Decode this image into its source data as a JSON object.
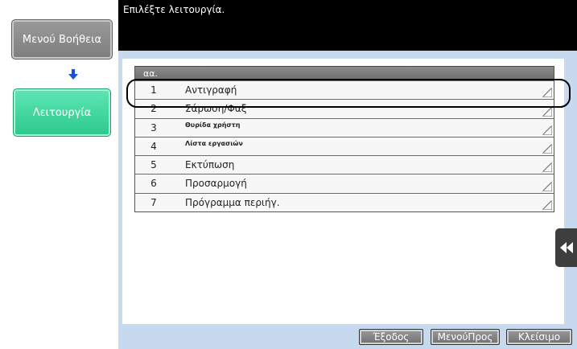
{
  "header": {
    "prompt": "Επιλέξτε λειτουργία."
  },
  "left_panel": {
    "help_menu_label": "Μενού Βοήθεια",
    "function_label": "Λειτουργία"
  },
  "list": {
    "header": "αα.",
    "items": [
      {
        "num": "1",
        "label": "Αντιγραφή",
        "selected": true
      },
      {
        "num": "2",
        "label": "Σάρωση/Φαξ"
      },
      {
        "num": "3",
        "label": "Θυρίδα χρήστη"
      },
      {
        "num": "4",
        "label": "Λίστα εργασιών"
      },
      {
        "num": "5",
        "label": "Εκτύπωση"
      },
      {
        "num": "6",
        "label": "Προσαρμογή"
      },
      {
        "num": "7",
        "label": "Πρόγραμμα περιήγ."
      }
    ]
  },
  "footer": {
    "exit_label": "Έξοδος",
    "menu_label": "ΜενούΠρος",
    "close_label": "Κλείσιμο"
  },
  "colors": {
    "content_bg": "#c6d9ef",
    "function_button": "#2cc98e",
    "arrow": "#1a4fd8"
  },
  "icons": {
    "arrow": "arrow-down-icon",
    "side_tab": "double-chevron-left-icon",
    "row_corner": "corner-triangle-icon"
  }
}
